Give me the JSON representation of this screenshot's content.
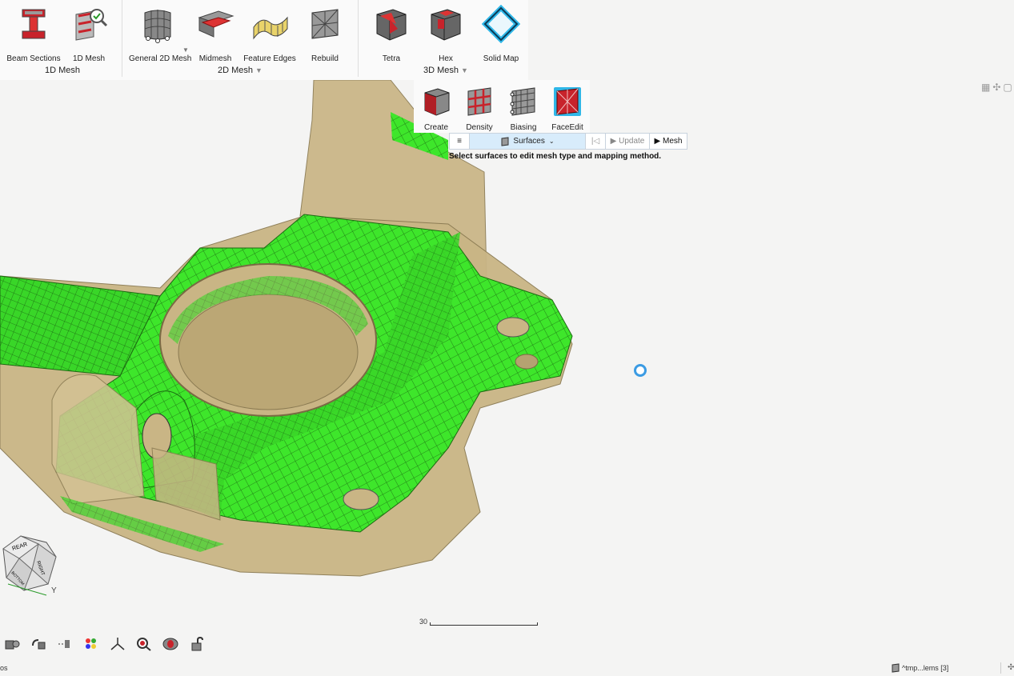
{
  "ribbon": {
    "groups": [
      {
        "label": "1D Mesh",
        "tools": [
          "Beam Sections",
          "1D Mesh"
        ]
      },
      {
        "label": "2D Mesh",
        "tools": [
          "General 2D Mesh",
          "Midmesh",
          "Feature Edges",
          "Rebuild"
        ]
      },
      {
        "label": "3D Mesh",
        "tools": [
          "Tetra",
          "Hex",
          "Solid Map"
        ]
      }
    ],
    "active_tool": "Solid Map"
  },
  "subtools": [
    "Create",
    "Density",
    "Biasing",
    "FaceEdit"
  ],
  "active_subtool": "FaceEdit",
  "guidebar": {
    "menu_icon": "≡",
    "selector": "Surfaces",
    "first_icon": "|◁",
    "update": "▶ Update",
    "mesh": "▶ Mesh"
  },
  "guide_message": "Select surfaces to edit mesh type and mapping method.",
  "viewcube": {
    "faces": [
      "REAR",
      "RIGHT",
      "BOTTOM"
    ],
    "axis": "Y"
  },
  "scale_label": "30",
  "status": {
    "left": "os",
    "right": "^tmp...lems [3]"
  },
  "colors": {
    "mesh_green": "#3ee62b",
    "solid_tan": "#c9b585",
    "accent_blue": "#2fb7e8",
    "tool_red": "#c8232b"
  }
}
